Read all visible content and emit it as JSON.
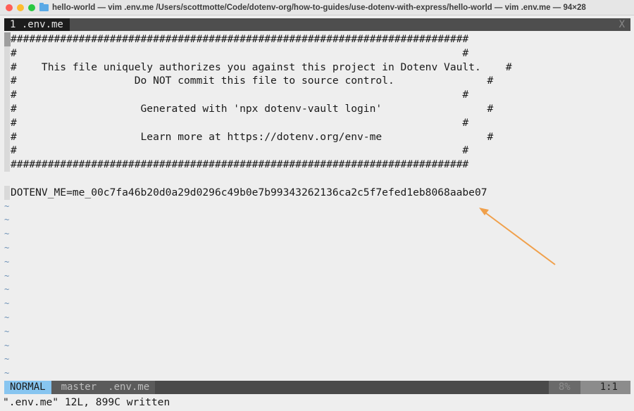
{
  "window": {
    "title": "hello-world — vim .env.me /Users/scottmotte/Code/dotenv-org/how-to-guides/use-dotenv-with-express/hello-world — vim .env.me — 94×28",
    "traffic_lights": {
      "close": "#ff5f57",
      "minimize": "#febc2e",
      "zoom": "#28c840"
    }
  },
  "tabline": {
    "active_tab": "1 .env.me",
    "close_label": "X"
  },
  "buffer": {
    "lines": [
      "##########################################################################",
      "#                                                                        #",
      "#    This file uniquely authorizes you against this project in Dotenv Vault.    #",
      "#                   Do NOT commit this file to source control.               #",
      "#                                                                        #",
      "#                    Generated with 'npx dotenv-vault login'                 #",
      "#                                                                        #",
      "#                    Learn more at https://dotenv.org/env-me                 #",
      "#                                                                        #",
      "##########################################################################",
      "",
      "DOTENV_ME=me_00c7fa46b20d0a29d0296c49b0e7b99343262136ca2c5f7efed1eb8068aabe07"
    ],
    "empty_line_marker": "~",
    "empty_line_count": 13
  },
  "statusline": {
    "mode": "NORMAL",
    "branch": "master",
    "filename": ".env.me",
    "percent": "8%",
    "position": "1:1"
  },
  "cmdline": {
    "message": "\".env.me\" 12L, 899C written"
  },
  "colors": {
    "accent_mode": "#87c5f0",
    "annotation_arrow": "#f0a04b"
  }
}
